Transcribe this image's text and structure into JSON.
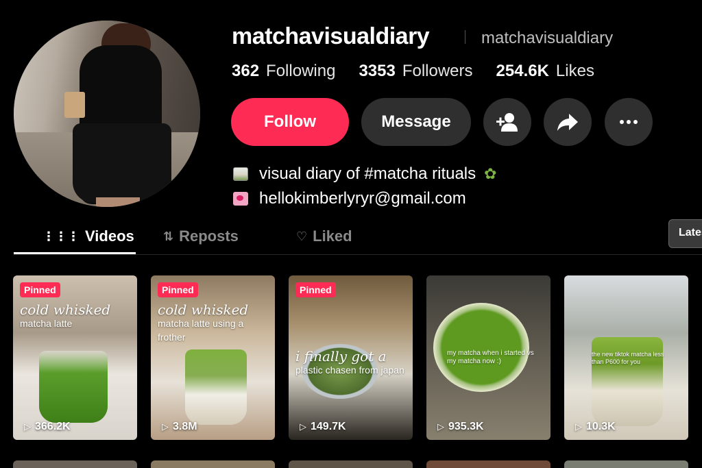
{
  "profile": {
    "username": "matchavisualdiary",
    "nickname": "matchavisualdiary",
    "following_count": "362",
    "following_label": "Following",
    "followers_count": "3353",
    "followers_label": "Followers",
    "likes_count": "254.6K",
    "likes_label": "Likes"
  },
  "actions": {
    "follow_label": "Follow",
    "message_label": "Message",
    "add_friend_icon": "person-plus-icon",
    "share_icon": "share-arrow-icon",
    "more_icon": "more-dots-icon"
  },
  "bio": {
    "line1": "visual diary of #matcha rituals",
    "line2": "hellokimberlyryr@gmail.com"
  },
  "tabs": {
    "videos": "Videos",
    "reposts": "Reposts",
    "liked": "Liked",
    "sort_label": "Lates"
  },
  "videos": [
    {
      "pinned": "Pinned",
      "caption": "cold whisked",
      "sub": "matcha latte",
      "views": "366.2K"
    },
    {
      "pinned": "Pinned",
      "caption": "cold whisked",
      "sub": "matcha latte using a frother",
      "views": "3.8M"
    },
    {
      "pinned": "Pinned",
      "caption": "i finally got a",
      "sub": "plastic chasen from japan",
      "views": "149.7K"
    },
    {
      "pinned": "",
      "caption": "",
      "sub": "my matcha when i started vs my matcha now :)",
      "views": "935.3K"
    },
    {
      "pinned": "",
      "caption": "",
      "sub": "the new tiktok matcha less than P600 for you",
      "views": "10.3K"
    }
  ]
}
